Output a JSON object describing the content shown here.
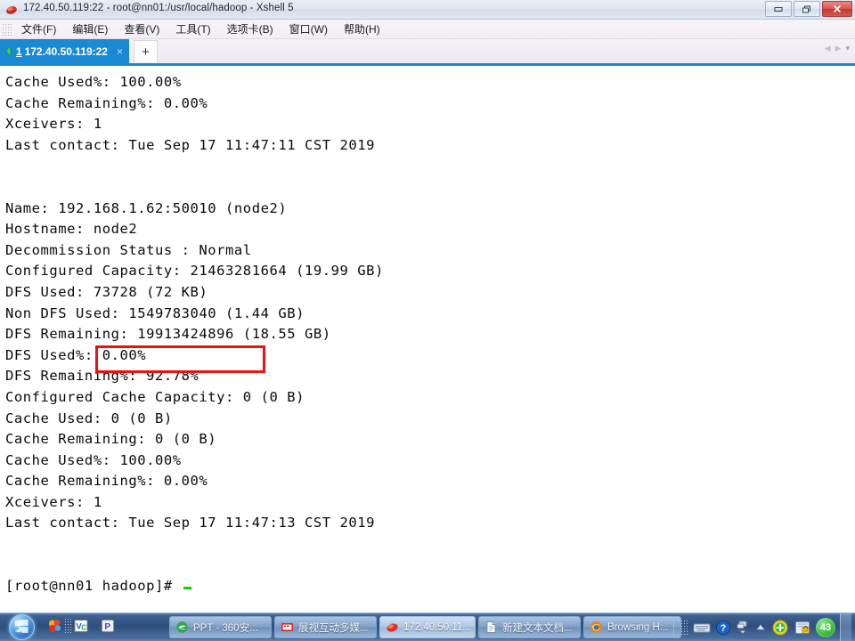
{
  "window": {
    "title": "172.40.50.119:22 - root@nn01:/usr/local/hadoop - Xshell 5",
    "app_icon": "xshell-icon",
    "controls": {
      "minimize": "minimize-button",
      "restore": "restore-button",
      "close": "close-button"
    }
  },
  "menubar": {
    "items": [
      {
        "label": "文件(F)",
        "name": "menu-file"
      },
      {
        "label": "编辑(E)",
        "name": "menu-edit"
      },
      {
        "label": "查看(V)",
        "name": "menu-view"
      },
      {
        "label": "工具(T)",
        "name": "menu-tools"
      },
      {
        "label": "选项卡(B)",
        "name": "menu-tabs"
      },
      {
        "label": "窗口(W)",
        "name": "menu-window"
      },
      {
        "label": "帮助(H)",
        "name": "menu-help"
      }
    ]
  },
  "tabbar": {
    "active_tab": {
      "index": "1",
      "label": "172.40.50.119:22",
      "close_glyph": "×",
      "status": "connected"
    },
    "new_tab_glyph": "+",
    "scroll_left_glyph": "◀",
    "scroll_right_glyph": "▶",
    "dropdown_glyph": "▾"
  },
  "terminal": {
    "prompt": "[root@nn01 hadoop]# ",
    "lines": [
      "Cache Used%: 100.00%",
      "Cache Remaining%: 0.00%",
      "Xceivers: 1",
      "Last contact: Tue Sep 17 11:47:11 CST 2019",
      "",
      "",
      "Name: 192.168.1.62:50010 (node2)",
      "Hostname: node2",
      "Decommission Status : Normal",
      "Configured Capacity: 21463281664 (19.99 GB)",
      "DFS Used: 73728 (72 KB)",
      "Non DFS Used: 1549783040 (1.44 GB)",
      "DFS Remaining: 19913424896 (18.55 GB)",
      "DFS Used%: 0.00%",
      "DFS Remaining%: 92.78%",
      "Configured Cache Capacity: 0 (0 B)",
      "Cache Used: 0 (0 B)",
      "Cache Remaining: 0 (0 B)",
      "Cache Used%: 100.00%",
      "Cache Remaining%: 0.00%",
      "Xceivers: 1",
      "Last contact: Tue Sep 17 11:47:13 CST 2019",
      "",
      ""
    ],
    "annotation": {
      "type": "rectangle",
      "color": "#ee1111",
      "highlighted_text": "73728 (72 KB)",
      "target_line": "DFS Used: 73728 (72 KB)"
    }
  },
  "taskbar": {
    "start_button": "start-orb",
    "quick_launch": [
      {
        "name": "ql-icon-browser",
        "glyph": ""
      },
      {
        "name": "ql-icon-grip",
        "glyph": ""
      },
      {
        "name": "ql-icon-vc",
        "glyph": "VC"
      },
      {
        "name": "ql-icon-p",
        "glyph": "P"
      }
    ],
    "tasks": [
      {
        "label": "PPT - 360安...",
        "icon": "ie-icon",
        "name": "task-ppt-360"
      },
      {
        "label": "展视互动多媒...",
        "icon": "video-icon",
        "name": "task-zhanshi"
      },
      {
        "label": "172.40.50.11...",
        "icon": "xshell-icon",
        "name": "task-xshell",
        "active": true
      },
      {
        "label": "新建文本文档...",
        "icon": "notepad-icon",
        "name": "task-notepad"
      },
      {
        "label": "Browsing H...",
        "icon": "firefox-icon",
        "name": "task-firefox"
      }
    ],
    "tray": {
      "items": [
        {
          "name": "tray-grip",
          "glyph": ""
        },
        {
          "name": "tray-keyboard-icon",
          "glyph": ""
        },
        {
          "name": "tray-help-icon",
          "glyph": "?"
        },
        {
          "name": "tray-network-icon",
          "glyph": ""
        },
        {
          "name": "tray-show-hidden-icon",
          "glyph": "▲"
        },
        {
          "name": "tray-update-icon",
          "glyph": "+"
        },
        {
          "name": "tray-security-icon",
          "glyph": ""
        }
      ],
      "badge": "43"
    }
  },
  "colors": {
    "tab_active": "#1a8ad4",
    "annotation_red": "#ee1111",
    "cursor_green": "#17cc17",
    "taskbar_blue": "#2f4f7d",
    "terminal_bg": "#ffffff",
    "terminal_fg": "#0a0a0a"
  }
}
